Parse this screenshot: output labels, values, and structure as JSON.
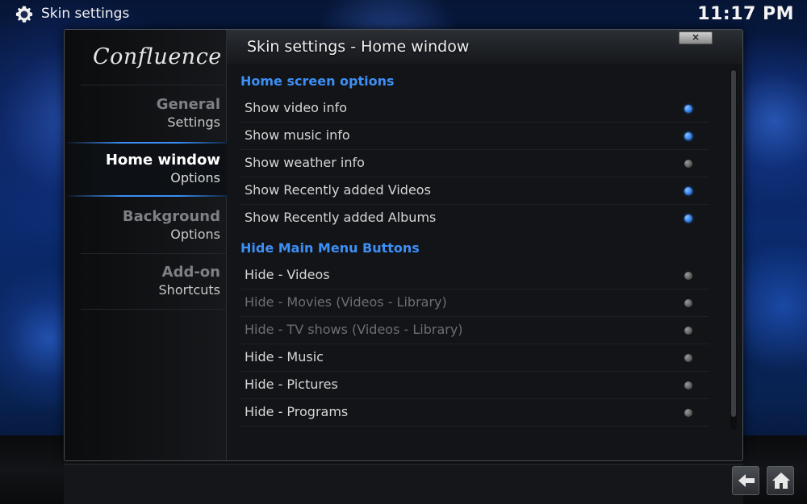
{
  "header": {
    "title": "Skin settings",
    "clock": "11:17 PM"
  },
  "dialog": {
    "title": "Skin settings - Home window",
    "close_label": "×"
  },
  "sidebar": {
    "logo": "Confluence",
    "items": [
      {
        "line1": "General",
        "line2": "Settings"
      },
      {
        "line1": "Home window",
        "line2": "Options"
      },
      {
        "line1": "Background",
        "line2": "Options"
      },
      {
        "line1": "Add-on",
        "line2": "Shortcuts"
      }
    ]
  },
  "sections": [
    {
      "header": "Home screen options",
      "rows": [
        {
          "label": "Show video info",
          "on": true
        },
        {
          "label": "Show music info",
          "on": true
        },
        {
          "label": "Show weather info",
          "on": false
        },
        {
          "label": "Show Recently added Videos",
          "on": true
        },
        {
          "label": "Show Recently added Albums",
          "on": true
        }
      ]
    },
    {
      "header": "Hide Main Menu Buttons",
      "rows": [
        {
          "label": "Hide - Videos",
          "on": false
        },
        {
          "label": "Hide - Movies  (Videos - Library)",
          "on": false,
          "disabled": true
        },
        {
          "label": "Hide - TV shows  (Videos - Library)",
          "on": false,
          "disabled": true
        },
        {
          "label": "Hide - Music",
          "on": false
        },
        {
          "label": "Hide - Pictures",
          "on": false
        },
        {
          "label": "Hide - Programs",
          "on": false
        }
      ]
    }
  ],
  "colors": {
    "accent": "#3d8ff5",
    "radio_on": "#2e7de8",
    "radio_off": "#5a5a5a"
  },
  "icons": {
    "header": "gear-icon",
    "back": "back-arrow-icon",
    "home": "home-icon"
  }
}
